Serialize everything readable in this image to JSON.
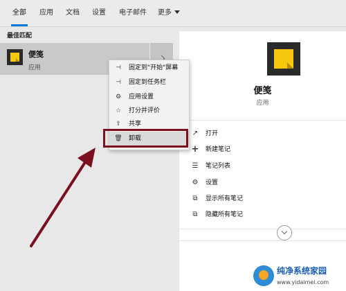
{
  "tabs": {
    "items": [
      {
        "label": "全部"
      },
      {
        "label": "应用"
      },
      {
        "label": "文档"
      },
      {
        "label": "设置"
      },
      {
        "label": "电子邮件"
      },
      {
        "label": "更多"
      }
    ],
    "active_index": 0,
    "accent": "#0078d7"
  },
  "left": {
    "section_title": "最佳匹配",
    "best_match": {
      "name": "便笺",
      "type": "应用",
      "icon": "sticky-notes-icon"
    }
  },
  "context_menu": {
    "items": [
      {
        "label": "固定到\"开始\"屏幕",
        "icon": "pin-icon"
      },
      {
        "label": "固定到任务栏",
        "icon": "pin-icon"
      },
      {
        "label": "应用设置",
        "icon": "gear-icon"
      },
      {
        "label": "打分并评价",
        "icon": "star-list-icon"
      },
      {
        "label": "共享",
        "icon": "share-icon"
      },
      {
        "label": "卸载",
        "icon": "trash-icon"
      }
    ],
    "highlighted": "卸载",
    "highlight_color": "#7a0f1f"
  },
  "right": {
    "title": "便笺",
    "subtitle": "应用",
    "actions": [
      {
        "label": "打开",
        "icon": "open-icon"
      },
      {
        "label": "新建笔记",
        "icon": "plus-icon"
      },
      {
        "label": "笔记列表",
        "icon": "list-icon"
      },
      {
        "label": "设置",
        "icon": "gear-icon"
      },
      {
        "label": "显示所有笔记",
        "icon": "show-notes-icon"
      },
      {
        "label": "隐藏所有笔记",
        "icon": "hide-notes-icon"
      }
    ]
  },
  "watermark": {
    "title": "纯净系统家园",
    "url": "www.yidaimei.com"
  }
}
